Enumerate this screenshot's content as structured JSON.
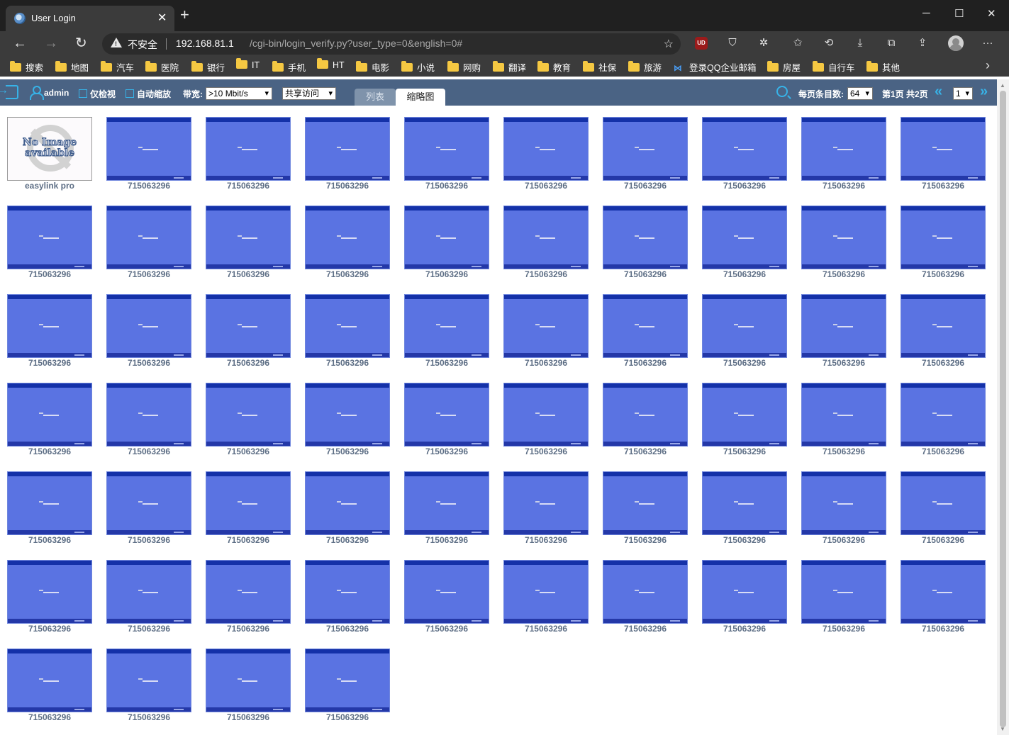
{
  "browser": {
    "tab_title": "User Login",
    "close_glyph": "✕",
    "newtab_glyph": "+",
    "window_controls": {
      "minimize": "─",
      "maximize": "☐",
      "close": "✕"
    },
    "nav": {
      "back": "←",
      "forward": "→",
      "reload": "↻"
    },
    "address": {
      "security_label": "不安全",
      "host": "192.168.81.1",
      "path": "/cgi-bin/login_verify.py?user_type=0&english=0#"
    },
    "extension_icons": [
      "ublock-icon",
      "shield-icon",
      "puzzle-icon",
      "favorites-icon",
      "history-icon",
      "download-icon",
      "collections-icon",
      "share-icon",
      "profile-icon",
      "more-icon"
    ],
    "more_glyph": "···",
    "bookmarks": [
      {
        "label": "搜索",
        "icon": "folder-icon"
      },
      {
        "label": "地图",
        "icon": "folder-icon"
      },
      {
        "label": "汽车",
        "icon": "folder-icon"
      },
      {
        "label": "医院",
        "icon": "folder-icon"
      },
      {
        "label": "银行",
        "icon": "folder-icon"
      },
      {
        "label": "IT",
        "icon": "folder-icon"
      },
      {
        "label": "手机",
        "icon": "folder-icon"
      },
      {
        "label": "HT",
        "icon": "folder-icon"
      },
      {
        "label": "电影",
        "icon": "folder-icon"
      },
      {
        "label": "小说",
        "icon": "folder-icon"
      },
      {
        "label": "网购",
        "icon": "folder-icon"
      },
      {
        "label": "翻译",
        "icon": "folder-icon"
      },
      {
        "label": "教育",
        "icon": "folder-icon"
      },
      {
        "label": "社保",
        "icon": "folder-icon"
      },
      {
        "label": "旅游",
        "icon": "folder-icon"
      },
      {
        "label": "登录QQ企业邮箱",
        "icon": "qq-mail-icon"
      },
      {
        "label": "房屋",
        "icon": "folder-icon"
      },
      {
        "label": "自行车",
        "icon": "folder-icon"
      },
      {
        "label": "其他",
        "icon": "folder-icon"
      }
    ],
    "bookmarks_more": "›"
  },
  "toolbar": {
    "username": "admin",
    "view_only_label": "仅检视",
    "auto_zoom_label": "自动缩放",
    "bandwidth_label": "带宽:",
    "bandwidth_value": ">10 Mbit/s",
    "access_value": "共享访问",
    "tab_list": "列表",
    "tab_thumbnail": "缩略图",
    "per_page_label": "每页条目数:",
    "per_page_value": "64",
    "page_info": "第1页 共2页",
    "page_select_value": "1",
    "prev_glyph": "«",
    "next_glyph": "»",
    "caret": "⌄"
  },
  "grid": {
    "no_image_text_line1": "No Image",
    "no_image_text_line2": "available",
    "items": [
      "easylink pro",
      "715063296",
      "715063296",
      "715063296",
      "715063296",
      "715063296",
      "715063296",
      "715063296",
      "715063296",
      "715063296",
      "715063296",
      "715063296",
      "715063296",
      "715063296",
      "715063296",
      "715063296",
      "715063296",
      "715063296",
      "715063296",
      "715063296",
      "715063296",
      "715063296",
      "715063296",
      "715063296",
      "715063296",
      "715063296",
      "715063296",
      "715063296",
      "715063296",
      "715063296",
      "715063296",
      "715063296",
      "715063296",
      "715063296",
      "715063296",
      "715063296",
      "715063296",
      "715063296",
      "715063296",
      "715063296",
      "715063296",
      "715063296",
      "715063296",
      "715063296",
      "715063296",
      "715063296",
      "715063296",
      "715063296",
      "715063296",
      "715063296",
      "715063296",
      "715063296",
      "715063296",
      "715063296",
      "715063296",
      "715063296",
      "715063296",
      "715063296",
      "715063296",
      "715063296",
      "715063296",
      "715063296",
      "715063296",
      "715063296"
    ]
  },
  "colors": {
    "toolbar_bg": "#4a6384",
    "accent": "#37b3e8",
    "thumb_blue": "#5a73e2",
    "caption": "#5d6e85"
  }
}
